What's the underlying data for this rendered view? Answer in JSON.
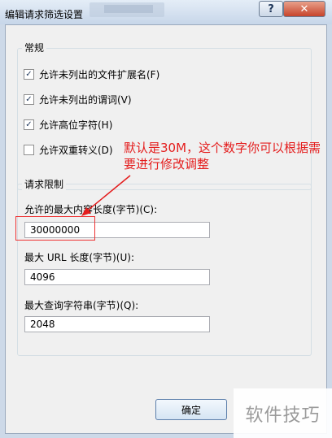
{
  "window": {
    "title": "编辑请求筛选设置"
  },
  "general": {
    "label": "常规",
    "options": [
      {
        "label": "允许未列出的文件扩展名(F)",
        "checked": true
      },
      {
        "label": "允许未列出的谓词(V)",
        "checked": true
      },
      {
        "label": "允许高位字符(H)",
        "checked": true
      },
      {
        "label": "允许双重转义(D)",
        "checked": false
      }
    ]
  },
  "limits": {
    "label": "请求限制",
    "max_content_label": "允许的最大内容长度(字节)(C):",
    "max_content_value": "30000000",
    "max_url_label": "最大 URL 长度(字节)(U):",
    "max_url_value": "4096",
    "max_query_label": "最大查询字符串(字节)(Q):",
    "max_query_value": "2048"
  },
  "annotation": {
    "text": "默认是30M，这个数字你可以根据需要进行修改调整"
  },
  "buttons": {
    "ok": "确定",
    "help": "?",
    "close": "✕"
  },
  "watermark": {
    "text": "软件技巧"
  },
  "icons": {
    "check": "✓"
  }
}
